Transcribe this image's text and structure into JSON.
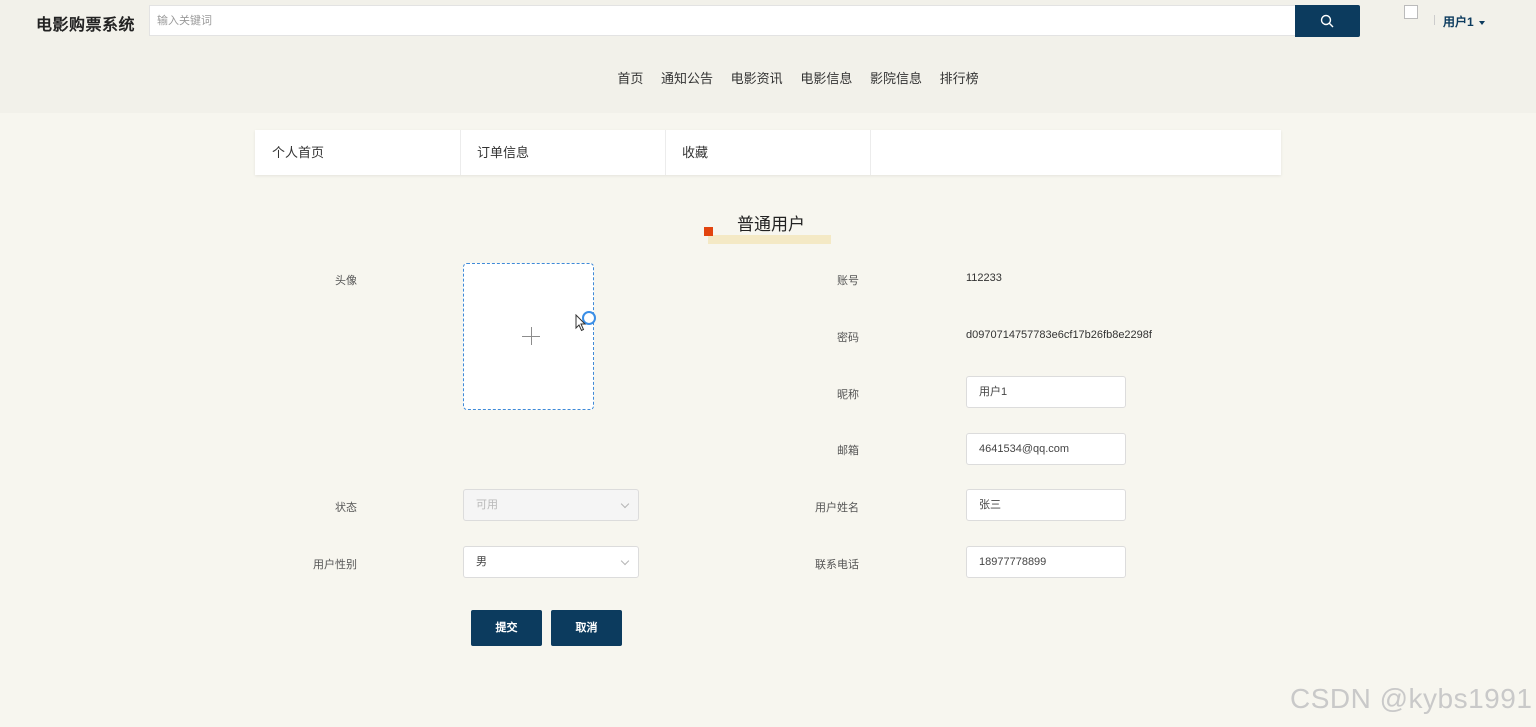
{
  "header": {
    "brand": "电影购票系统",
    "search_placeholder": "输入关键词",
    "user_name": "用户1"
  },
  "nav": {
    "items": [
      "首页",
      "通知公告",
      "电影资讯",
      "电影信息",
      "影院信息",
      "排行榜"
    ]
  },
  "tabs": [
    "个人首页",
    "订单信息",
    "收藏"
  ],
  "section": {
    "title": "普通用户"
  },
  "form": {
    "avatar_label": "头像",
    "account_label": "账号",
    "account_value": "112233",
    "password_label": "密码",
    "password_value": "d0970714757783e6cf17b26fb8e2298f",
    "nickname_label": "昵称",
    "nickname_value": "用户1",
    "email_label": "邮箱",
    "email_value": "4641534@qq.com",
    "status_label": "状态",
    "status_value": "可用",
    "realname_label": "用户姓名",
    "realname_value": "张三",
    "gender_label": "用户性别",
    "gender_value": "男",
    "phone_label": "联系电话",
    "phone_value": "18977778899",
    "submit_label": "提交",
    "cancel_label": "取消"
  },
  "watermark": "CSDN @kybs1991",
  "colors": {
    "primary": "#0c3b5e",
    "accent_mark": "#e2440f",
    "upload_border": "#3f8ad8",
    "page_bg": "#f7f6ef"
  }
}
